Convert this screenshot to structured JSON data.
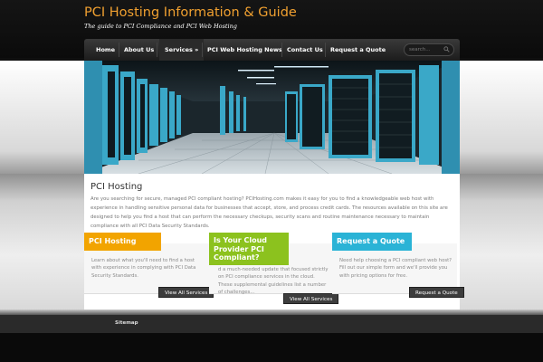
{
  "header": {
    "site_title": "PCI Hosting Information & Guide",
    "tagline": "The guide to PCI Compliance and PCI Web Hosting"
  },
  "nav": {
    "items": [
      {
        "label": "Home"
      },
      {
        "label": "About Us"
      },
      {
        "label": "Services »"
      },
      {
        "label": "PCI Web Hosting News"
      },
      {
        "label": "Contact Us"
      },
      {
        "label": "Request a Quote"
      }
    ],
    "search_placeholder": "search..."
  },
  "intro": {
    "title": "PCI Hosting",
    "text": "Are you searching for secure, managed PCI compliant hosting? PCIHosting.com makes it easy for you to find a knowledgeable web host with experience in handling sensitive personal data for businesses that accept, store, and process credit cards. The resources available on this site are designed to help you find a host that can perform the necessary checkups, security scans and routine maintenance necessary to maintain compliance with all PCI Data Security Standards."
  },
  "boxes": [
    {
      "title": "PCI Hosting",
      "text": "Learn about what you'll need to find a host with experience in complying with PCI Data Security Standards.",
      "button": "View All Services",
      "color": "#f2a400"
    },
    {
      "title": "Is Your Cloud Provider PCI Compliant?",
      "text": "d a much-needed update that focused strictly on PCI compliance services in the cloud. These supplemental guidelines list a number of challenges...",
      "button": "View All Services",
      "color": "#8cc21e"
    },
    {
      "title": "Request a Quote",
      "text": "Need help choosing a PCI compliant web host? Fill out our simple form and we'll provide you with pricing options for free.",
      "button": "Request a Quote",
      "color": "#2ab3d6"
    }
  ],
  "footer": {
    "link": "Sitemap"
  },
  "colors": {
    "title_orange": "#f0a030",
    "server_teal": "#3aa8c8"
  }
}
